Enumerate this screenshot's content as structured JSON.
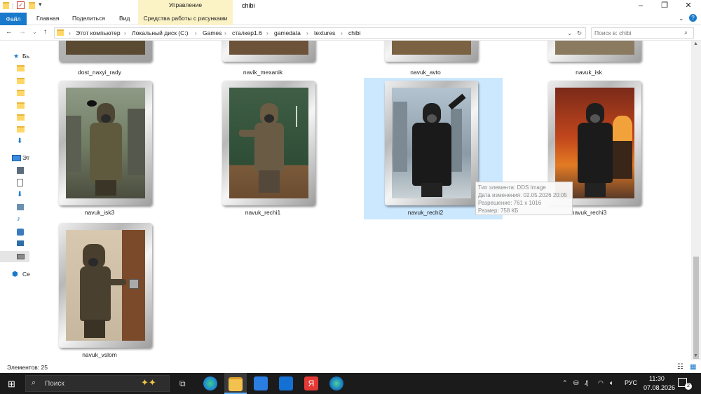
{
  "window": {
    "title": "chibi",
    "context_group_top": "Управление",
    "context_group_bottom": "Средства работы с рисунками",
    "ribbon_tabs": [
      "Файл",
      "Главная",
      "Поделиться",
      "Вид"
    ],
    "controls": {
      "minimize": "–",
      "maximize": "❐",
      "close": "✕"
    }
  },
  "address": {
    "breadcrumbs": [
      "Этот компьютер",
      "Локальный диск (C:)",
      "Games",
      "сталкер1.6",
      "gamedata",
      "textures",
      "chibi"
    ],
    "search_placeholder": "Поиск в: chibi"
  },
  "navpane": {
    "items": [
      "Бь",
      "",
      "",
      "",
      "",
      "",
      "",
      "",
      "Эт",
      "",
      "",
      "",
      "",
      "",
      "",
      "",
      "",
      "",
      "Се"
    ]
  },
  "files": {
    "top_row": [
      "dost_naxyi_rady",
      "navik_mexanik",
      "navuk_avto",
      "navuk_isk"
    ],
    "row2": [
      "navuk_isk3",
      "navuk_rechi1",
      "navuk_rechi2",
      "navuk_rechi3"
    ],
    "row3": [
      "navuk_vslom"
    ]
  },
  "tooltip": {
    "line1": "Тип элемента: DDS Image",
    "line2": "Дата изменения: 02.05.2026 20:05",
    "line3": "Разрешение: 761 x 1016",
    "line4": "Размер: 758 КБ"
  },
  "status": {
    "count": "Элементов: 25"
  },
  "taskbar": {
    "search_label": "Поиск",
    "lang": "РУС",
    "time": "11:30",
    "date": "07.08.2026",
    "notifications": "2"
  },
  "colors": {
    "accent": "#1979ca",
    "selection": "#cce8ff",
    "ribbon_context": "#fbf2c5",
    "taskbar": "#1b1b1b"
  }
}
